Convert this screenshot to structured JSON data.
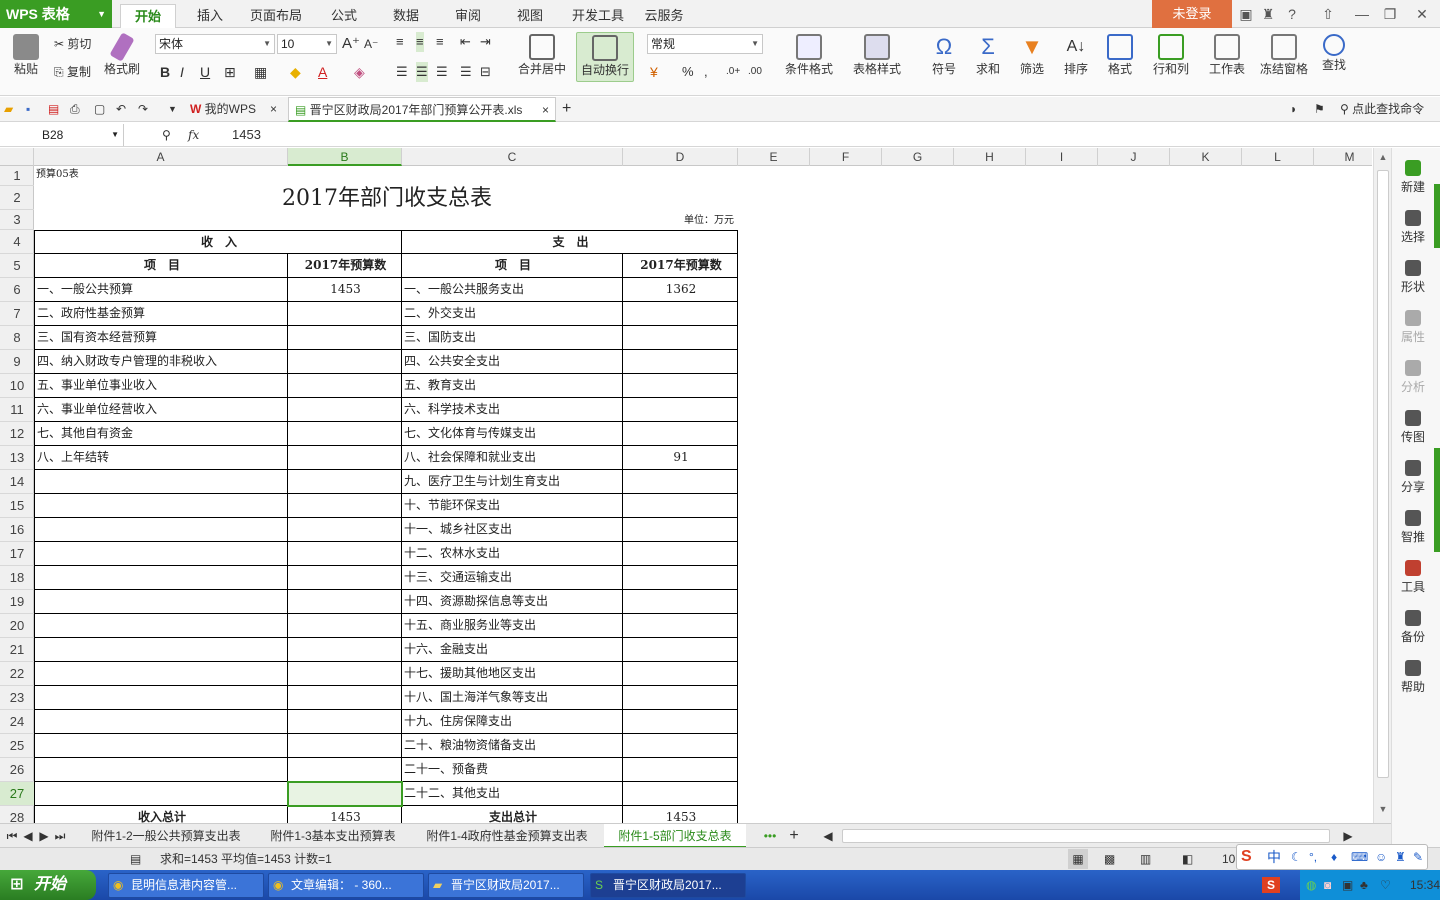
{
  "app": {
    "logo": "WPS 表格",
    "login": "未登录"
  },
  "menu_tabs": [
    "开始",
    "插入",
    "页面布局",
    "公式",
    "数据",
    "审阅",
    "视图",
    "开发工具",
    "云服务"
  ],
  "ribbon": {
    "paste": "粘贴",
    "cut": "剪切",
    "copy": "复制",
    "format_painter": "格式刷",
    "font_name": "宋体",
    "font_size": "10",
    "merge_center": "合并居中",
    "wrap_text": "自动换行",
    "number_format": "常规",
    "conditional_format": "条件格式",
    "table_style": "表格样式",
    "symbol": "符号",
    "sum": "求和",
    "filter": "筛选",
    "sort": "排序",
    "format": "格式",
    "row_col": "行和列",
    "worksheet": "工作表",
    "freeze": "冻结窗格",
    "find": "查找"
  },
  "doc_tabs": {
    "home": "我的WPS",
    "file": "晋宁区财政局2017年部门预算公开表.xls",
    "search_cmd": "点此查找命令"
  },
  "formula": {
    "cell_ref": "B28",
    "fx": "fx",
    "value": "1453"
  },
  "columns": [
    "A",
    "B",
    "C",
    "D",
    "E",
    "F",
    "G",
    "H",
    "I",
    "J",
    "K",
    "L",
    "M"
  ],
  "rows": [
    "1",
    "2",
    "3",
    "4",
    "5",
    "6",
    "7",
    "8",
    "9",
    "10",
    "11",
    "12",
    "13",
    "14",
    "15",
    "16",
    "17",
    "18",
    "19",
    "20",
    "21",
    "22",
    "23",
    "24",
    "25",
    "26",
    "27",
    "28"
  ],
  "sheet": {
    "r1": "预算05表",
    "title": "2017年部门收支总表",
    "unit": "单位：万元",
    "income_header": "收　入",
    "expense_header": "支　出",
    "item_header": "项　目",
    "budget_header": "2017年预算数",
    "income_items": [
      "一、一般公共预算",
      "二、政府性基金预算",
      "三、国有资本经营预算",
      "四、纳入财政专户管理的非税收入",
      "五、事业单位事业收入",
      "六、事业单位经营收入",
      "七、其他自有资金",
      "八、上年结转"
    ],
    "income_values": [
      "1453",
      "",
      "",
      "",
      "",
      "",
      "",
      ""
    ],
    "expense_items": [
      "一、一般公共服务支出",
      "二、外交支出",
      "三、国防支出",
      "四、公共安全支出",
      "五、教育支出",
      "六、科学技术支出",
      "七、文化体育与传媒支出",
      "八、社会保障和就业支出",
      "九、医疗卫生与计划生育支出",
      "十、节能环保支出",
      "十一、城乡社区支出",
      "十二、农林水支出",
      "十三、交通运输支出",
      "十四、资源勘探信息等支出",
      "十五、商业服务业等支出",
      "十六、金融支出",
      "十七、援助其他地区支出",
      "十八、国土海洋气象等支出",
      "十九、住房保障支出",
      "二十、粮油物资储备支出",
      "二十一、预备费",
      "二十二、其他支出"
    ],
    "expense_values": [
      "1362",
      "",
      "",
      "",
      "",
      "",
      "",
      "91",
      "",
      "",
      "",
      "",
      "",
      "",
      "",
      "",
      "",
      "",
      "",
      "",
      "",
      ""
    ],
    "income_total_label": "收入总计",
    "income_total": "1453",
    "expense_total_label": "支出总计",
    "expense_total": "1453"
  },
  "right_panel": [
    "新建",
    "选择",
    "形状",
    "属性",
    "分析",
    "传图",
    "分享",
    "智推",
    "工具",
    "备份",
    "帮助"
  ],
  "sheet_tabs": [
    "附件1-2一般公共预算支出表",
    "附件1-3基本支出预算表",
    "附件1-4政府性基金预算支出表",
    "附件1-5部门收支总表"
  ],
  "status": {
    "summary": "求和=1453  平均值=1453  计数=1",
    "zoom": "10"
  },
  "taskbar": {
    "start": "开始",
    "tasks": [
      "昆明信息港内容管...",
      "文章编辑： - 360...",
      "晋宁区财政局2017...",
      "晋宁区财政局2017..."
    ],
    "ime": "中",
    "time": "15:34"
  },
  "colors": {
    "accent": "#3a9d23",
    "login": "#e07040",
    "taskbar": "#2a63c8",
    "selection": "#d8ebd0"
  }
}
